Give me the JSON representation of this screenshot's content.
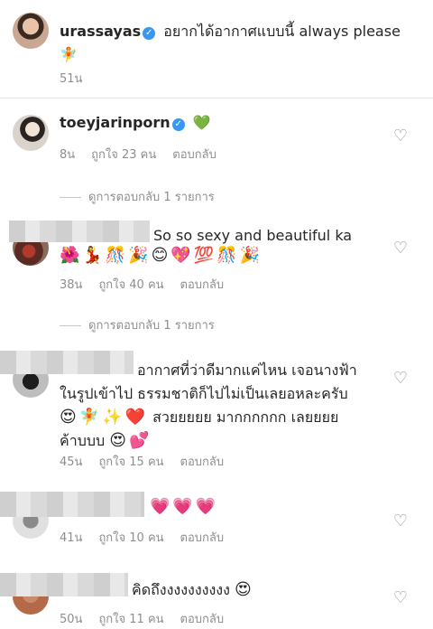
{
  "caption": {
    "username": "urassayas",
    "text": "อยากได้อากาศแบบนี้ always please",
    "emoji": "🧚",
    "time": "51น"
  },
  "comments": [
    {
      "username": "toeyjarinporn",
      "text": "💚",
      "time": "8น",
      "likes": "ถูกใจ 23 คน",
      "reply": "ตอบกลับ",
      "view_replies": "ดูการตอบกลับ 1 รายการ"
    },
    {
      "text": "So so sexy and beautiful ka",
      "emoji": "🌺💃🎊🎉😊💖💯🎊🎉",
      "time": "38น",
      "likes": "ถูกใจ 40 คน",
      "reply": "ตอบกลับ",
      "view_replies": "ดูการตอบกลับ 1 รายการ"
    },
    {
      "line1": "อากาศที่ว่าดีมากแค่ไหน เจอนางฟ้า",
      "line2": "ในรูปเข้าไป ธรรมชาติก็ไปไม่เป็นเลยอหละครับ",
      "line3_emoji": "😍🧚✨❤️",
      "line3_text": "สวยยยยย มากกกกกก เลยยยย",
      "line4_text": "ค้าบบบ",
      "line4_emoji": "😍💕",
      "time": "45น",
      "likes": "ถูกใจ 15 คน",
      "reply": "ตอบกลับ"
    },
    {
      "emoji": "💗💗💗",
      "time": "41น",
      "likes": "ถูกใจ 10 คน",
      "reply": "ตอบกลับ"
    },
    {
      "text": "คิดถึงงงงงงงงงง",
      "emoji": "😍",
      "time": "50น",
      "likes": "ถูกใจ 11 คน",
      "reply": "ตอบกลับ"
    }
  ],
  "icons": {
    "heart": "heart-outline-icon",
    "verified": "verified-badge-icon"
  },
  "colors": {
    "verified": "#3897f0",
    "meta": "#8e8e8e",
    "text": "#262626"
  }
}
